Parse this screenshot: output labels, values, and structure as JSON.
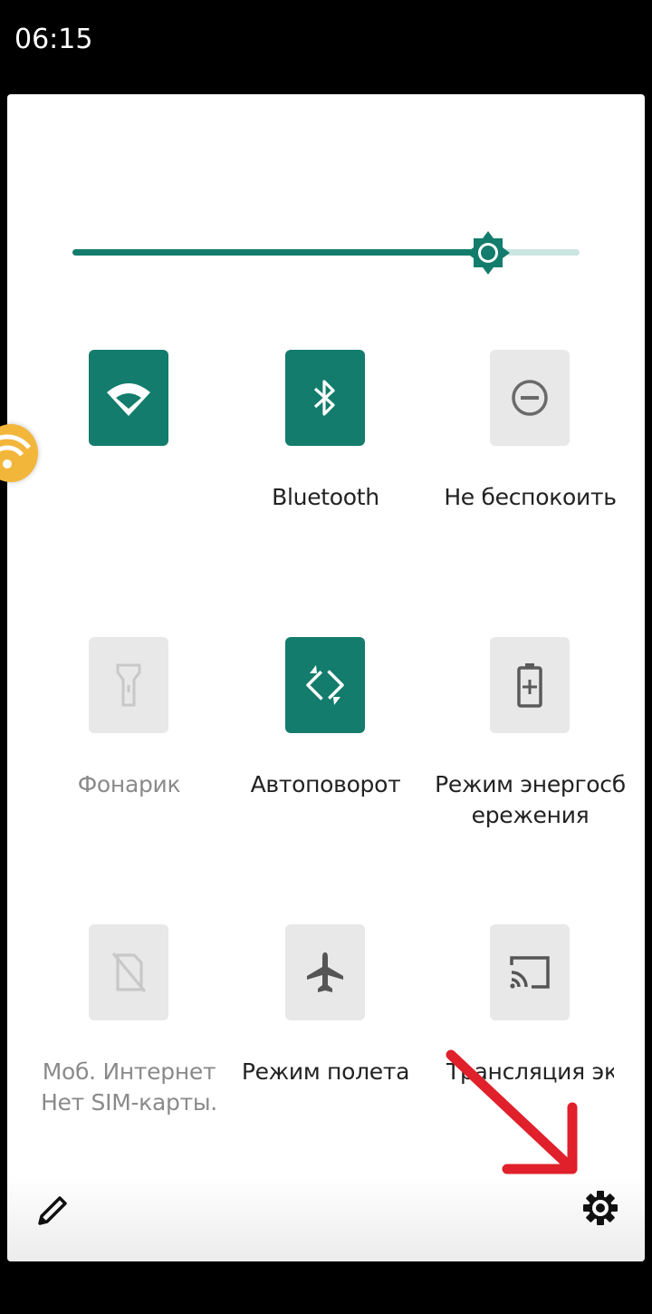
{
  "status_bar": {
    "time": "06:15"
  },
  "brightness": {
    "level": 0.82
  },
  "tiles": [
    {
      "label": "",
      "icon": "wifi-icon",
      "active": true
    },
    {
      "label": "Bluetooth",
      "icon": "bluetooth-icon",
      "active": true
    },
    {
      "label": "Не беспокоить",
      "icon": "do-not-disturb-icon",
      "active": false
    },
    {
      "label": "Фонарик",
      "icon": "flashlight-icon",
      "active": false,
      "disabled": true
    },
    {
      "label": "Автоповорот",
      "icon": "auto-rotate-icon",
      "active": true
    },
    {
      "label": "Режим энергосб\nережения",
      "icon": "battery-saver-icon",
      "active": false
    },
    {
      "label": "Моб. Интернет\nНет SIM-карты.",
      "icon": "no-sim-icon",
      "active": false,
      "disabled": true
    },
    {
      "label": "Режим полета",
      "icon": "airplane-icon",
      "active": false
    },
    {
      "label": "Трансляция экрана",
      "icon": "cast-icon",
      "active": false
    }
  ],
  "footer": {
    "edit_icon": "edit-icon",
    "settings_icon": "gear-icon"
  },
  "colors": {
    "accent": "#137c6c",
    "tile_off": "#e8e8e8",
    "annotation": "#e0202a"
  }
}
